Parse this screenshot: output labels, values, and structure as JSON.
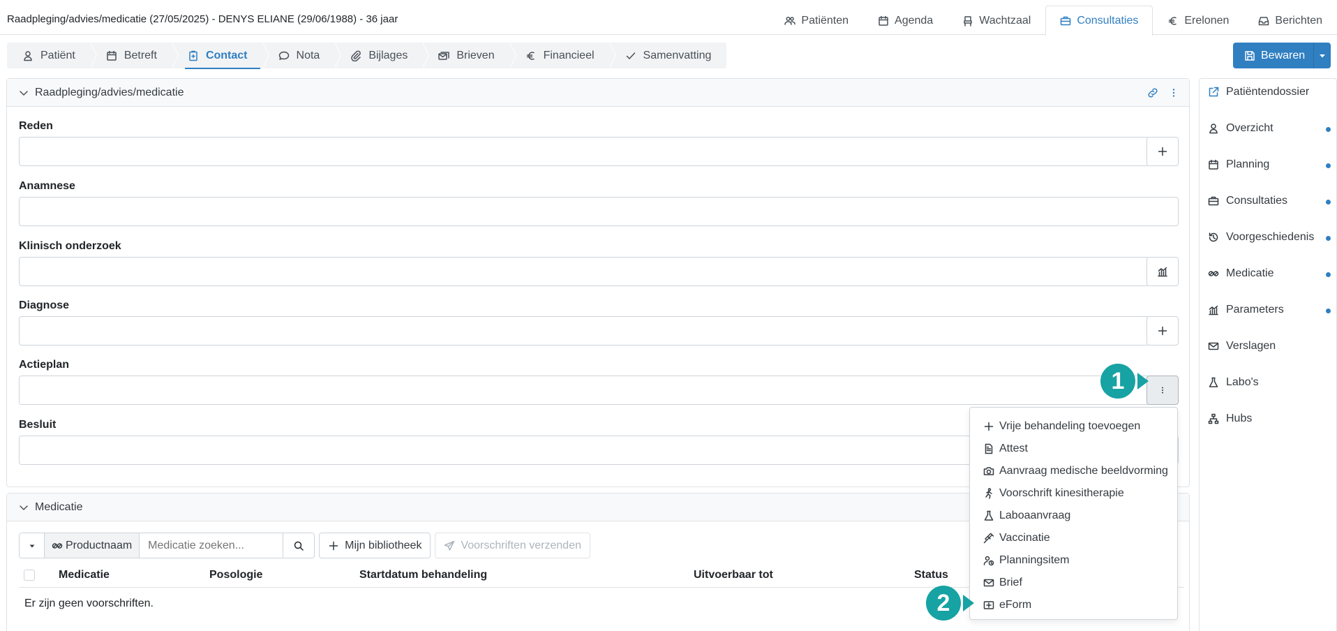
{
  "header": {
    "title": "Raadpleging/advies/medicatie (27/05/2025) - DENYS ELIANE (29/06/1988) - 36 jaar",
    "nav": [
      {
        "label": "Patiënten",
        "icon": "users-icon"
      },
      {
        "label": "Agenda",
        "icon": "calendar-icon"
      },
      {
        "label": "Wachtzaal",
        "icon": "chair-icon"
      },
      {
        "label": "Consultaties",
        "icon": "briefcase-icon",
        "active": true
      },
      {
        "label": "Erelonen",
        "icon": "euro-icon"
      },
      {
        "label": "Berichten",
        "icon": "inbox-icon"
      }
    ]
  },
  "tabs": [
    {
      "label": "Patiënt",
      "icon": "person-icon"
    },
    {
      "label": "Betreft",
      "icon": "calendar-icon"
    },
    {
      "label": "Contact",
      "icon": "clipboard-icon",
      "active": true
    },
    {
      "label": "Nota",
      "icon": "chat-icon"
    },
    {
      "label": "Bijlages",
      "icon": "paperclip-icon"
    },
    {
      "label": "Brieven",
      "icon": "envelopes-icon"
    },
    {
      "label": "Financieel",
      "icon": "euro-icon"
    },
    {
      "label": "Samenvatting",
      "icon": "check-icon"
    }
  ],
  "save": {
    "label": "Bewaren"
  },
  "consult_panel": {
    "title": "Raadpleging/advies/medicatie",
    "fields": {
      "reden": "Reden",
      "anamnese": "Anamnese",
      "klinisch": "Klinisch onderzoek",
      "diagnose": "Diagnose",
      "actieplan": "Actieplan",
      "besluit": "Besluit"
    }
  },
  "dropdown": {
    "items": [
      {
        "label": "Vrije behandeling toevoegen",
        "icon": "plus-icon"
      },
      {
        "label": "Attest",
        "icon": "document-icon"
      },
      {
        "label": "Aanvraag medische beeldvorming",
        "icon": "camera-icon"
      },
      {
        "label": "Voorschrift kinesitherapie",
        "icon": "running-person-icon"
      },
      {
        "label": "Laboaanvraag",
        "icon": "flask-icon"
      },
      {
        "label": "Vaccinatie",
        "icon": "syringe-icon"
      },
      {
        "label": "Planningsitem",
        "icon": "person-clock-icon"
      },
      {
        "label": "Brief",
        "icon": "envelope-icon"
      },
      {
        "label": "eForm",
        "icon": "eform-icon"
      }
    ]
  },
  "medication_panel": {
    "title": "Medicatie",
    "toolbar": {
      "productnaam": "Productnaam",
      "search_placeholder": "Medicatie zoeken...",
      "library": "Mijn bibliotheek",
      "send": "Voorschriften verzenden"
    },
    "columns": [
      "Medicatie",
      "Posologie",
      "Startdatum behandeling",
      "Uitvoerbaar tot",
      "Status"
    ],
    "empty": "Er zijn geen voorschriften."
  },
  "sidebar": {
    "items": [
      {
        "label": "Patiëntendossier",
        "icon": "external-edit-icon",
        "dot": false
      },
      {
        "label": "Overzicht",
        "icon": "person-icon",
        "dot": true
      },
      {
        "label": "Planning",
        "icon": "calendar-icon",
        "dot": true
      },
      {
        "label": "Consultaties",
        "icon": "briefcase-icon",
        "dot": true
      },
      {
        "label": "Voorgeschiedenis",
        "icon": "history-icon",
        "dot": true
      },
      {
        "label": "Medicatie",
        "icon": "pills-icon",
        "dot": true
      },
      {
        "label": "Parameters",
        "icon": "chart-icon",
        "dot": true
      },
      {
        "label": "Verslagen",
        "icon": "envelope-icon",
        "dot": false
      },
      {
        "label": "Labo's",
        "icon": "flask-icon",
        "dot": false
      },
      {
        "label": "Hubs",
        "icon": "hierarchy-icon",
        "dot": false
      }
    ]
  },
  "markers": [
    "1",
    "2"
  ],
  "colors": {
    "accent": "#2f7fc1",
    "marker": "#17a2a3"
  }
}
